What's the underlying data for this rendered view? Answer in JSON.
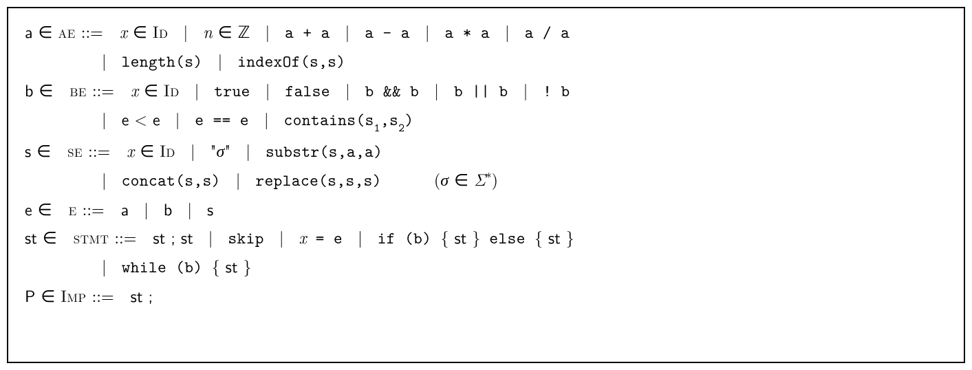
{
  "grammar": {
    "ae": {
      "lhs_var": "a",
      "in": "∈",
      "nonterminal": "ae",
      "def": "::=",
      "alt1_var": "x",
      "alt1_nt": "Id",
      "alt2_var": "n",
      "alt2_set": "ℤ",
      "alt3": "a + a",
      "alt4": "a - a",
      "alt5": "a * a",
      "alt6": "a / a",
      "alt7": "length(s)",
      "alt8": "indexOf(s,s)"
    },
    "be": {
      "lhs_var": "b",
      "nonterminal": "be",
      "alt1_var": "x",
      "alt1_nt": "Id",
      "alt2": "true",
      "alt3": "false",
      "alt4": "b && b",
      "alt5": "b || b",
      "alt6": "! b",
      "alt7_l": "e",
      "alt7_op": "<",
      "alt7_r": "e",
      "alt8": "e == e",
      "alt9_fn": "contains(s",
      "alt9_sub1": "1",
      "alt9_mid": ",s",
      "alt9_sub2": "2",
      "alt9_end": ")"
    },
    "se": {
      "lhs_var": "s",
      "nonterminal": "se",
      "alt1_var": "x",
      "alt1_nt": "Id",
      "alt2_q1": "\"",
      "alt2_sigma": "σ",
      "alt2_q2": "\"",
      "alt3": "substr(s,a,a)",
      "alt4": "concat(s,s)",
      "alt5": "replace(s,s,s)",
      "side_open": "(",
      "side_sigma": "σ",
      "side_in": "∈",
      "side_Sigma": "Σ",
      "side_star": "∗",
      "side_close": ")"
    },
    "e": {
      "lhs_var": "e",
      "nonterminal": "e",
      "alt1": "a",
      "alt2": "b",
      "alt3": "s"
    },
    "stmt": {
      "lhs_var": "st",
      "nonterminal": "stmt",
      "alt1": "st ; st",
      "alt2": "skip",
      "alt3_var": "x",
      "alt3_rest": " = e",
      "alt4_if": "if (b) ",
      "alt4_lb1": "{",
      "alt4_st1": " st ",
      "alt4_rb1": "}",
      "alt4_else": " else ",
      "alt4_lb2": "{",
      "alt4_st2": " st ",
      "alt4_rb2": "}",
      "alt5_while": "while (b) ",
      "alt5_lb": "{",
      "alt5_st": " st ",
      "alt5_rb": "}"
    },
    "imp": {
      "lhs_var": "P",
      "nonterminal": "Imp",
      "rhs": "st ;"
    },
    "pipe": "|"
  }
}
